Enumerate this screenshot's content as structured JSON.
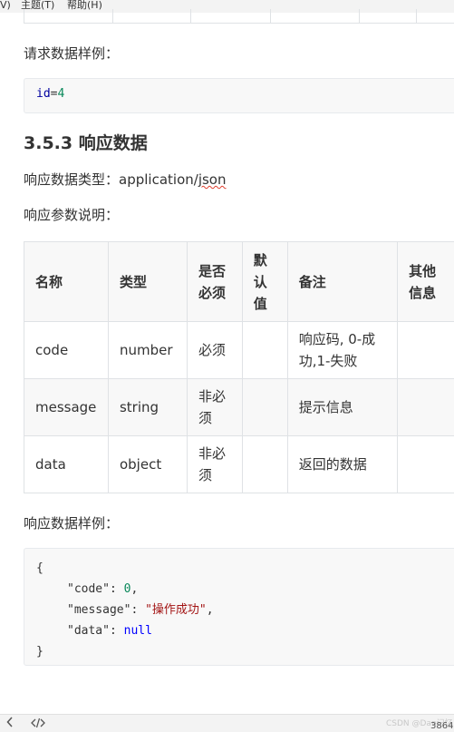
{
  "menubar": {
    "items": [
      "V)",
      "主题(T)",
      "帮助(H)"
    ]
  },
  "request": {
    "sample_label": "请求数据样例：",
    "code": {
      "key": "id",
      "op": "=",
      "value": "4"
    }
  },
  "response": {
    "heading": "3.5.3 响应数据",
    "type_label": "响应数据类型：",
    "type_value_prefix": "application/",
    "type_value_suffix": "json",
    "params_label": "响应参数说明：",
    "table": {
      "headers": {
        "name": "名称",
        "type": "类型",
        "required": "是否必须",
        "default": "默认值",
        "remark": "备注",
        "other": "其他信息"
      },
      "rows": [
        {
          "name": "code",
          "type": "number",
          "required": "必须",
          "default": "",
          "remark": "响应码, 0-成功,1-失败",
          "other": ""
        },
        {
          "name": "message",
          "type": "string",
          "required": "非必须",
          "default": "",
          "remark": "提示信息",
          "other": ""
        },
        {
          "name": "data",
          "type": "object",
          "required": "非必须",
          "default": "",
          "remark": "返回的数据",
          "other": ""
        }
      ]
    },
    "sample_label": "响应数据样例：",
    "sample": {
      "open": "{",
      "close": "}",
      "lines": [
        {
          "key": "\"code\"",
          "sep": ": ",
          "value": "0",
          "trail": ",",
          "kind": "num"
        },
        {
          "key": "\"message\"",
          "sep": ": ",
          "value": "\"操作成功\"",
          "trail": ",",
          "kind": "str"
        },
        {
          "key": "\"data\"",
          "sep": ": ",
          "value": "null",
          "trail": "",
          "kind": "kw"
        }
      ]
    }
  },
  "statusbar": {
    "back_icon": "chevron-left-icon",
    "source_icon": "code-icon",
    "watermark": "CSDN @Dan记忆",
    "word_count": "3864"
  }
}
